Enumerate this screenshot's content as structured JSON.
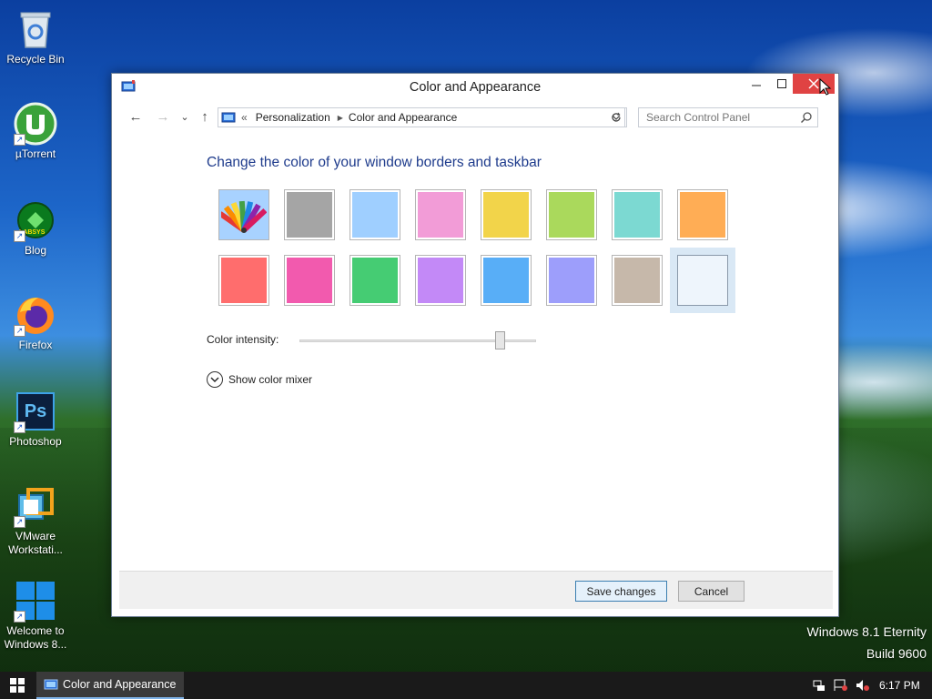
{
  "desktop": {
    "icons": [
      {
        "label": "Recycle Bin"
      },
      {
        "label": "µTorrent"
      },
      {
        "label": "Blog",
        "badge": "LABSYS"
      },
      {
        "label": "Firefox"
      },
      {
        "label": "Photoshop",
        "glyph": "Ps"
      },
      {
        "label": "VMware Workstati..."
      },
      {
        "label": "Welcome to Windows 8..."
      }
    ],
    "watermark": {
      "line1": "Windows 8.1 Eternity",
      "line2": "Build 9600"
    }
  },
  "window": {
    "title": "Color and Appearance",
    "nav": {
      "back": "←",
      "forward": "→",
      "recent": "⌄",
      "up": "↑"
    },
    "address": {
      "overflow": "«",
      "segments": [
        "Personalization",
        "Color and Appearance"
      ]
    },
    "search": {
      "placeholder": "Search Control Panel"
    },
    "heading": "Change the color of your window borders and taskbar",
    "swatches": {
      "row1": [
        "automatic",
        "#a5a5a5",
        "#9fcfff",
        "#f29cd7",
        "#f2d44a",
        "#aad95c",
        "#7cd9d2",
        "#ffad55"
      ],
      "row2": [
        "#ff6d6d",
        "#f25aae",
        "#45cc73",
        "#c389f7",
        "#58aef7",
        "#9d9efb",
        "#c6b8aa",
        "#eef5fc"
      ],
      "selected": "#eef5fc"
    },
    "intensity": {
      "label": "Color intensity:",
      "value": 0.85
    },
    "mixer": {
      "label": "Show color mixer"
    },
    "buttons": {
      "save": "Save changes",
      "cancel": "Cancel"
    }
  },
  "taskbar": {
    "active_item": "Color and Appearance",
    "clock": "6:17 PM"
  },
  "colors": {
    "heading": "#1e3b8c",
    "close_button": "#e04343",
    "taskbar": "#1a1a1a",
    "accent": "#3c7fb1"
  }
}
